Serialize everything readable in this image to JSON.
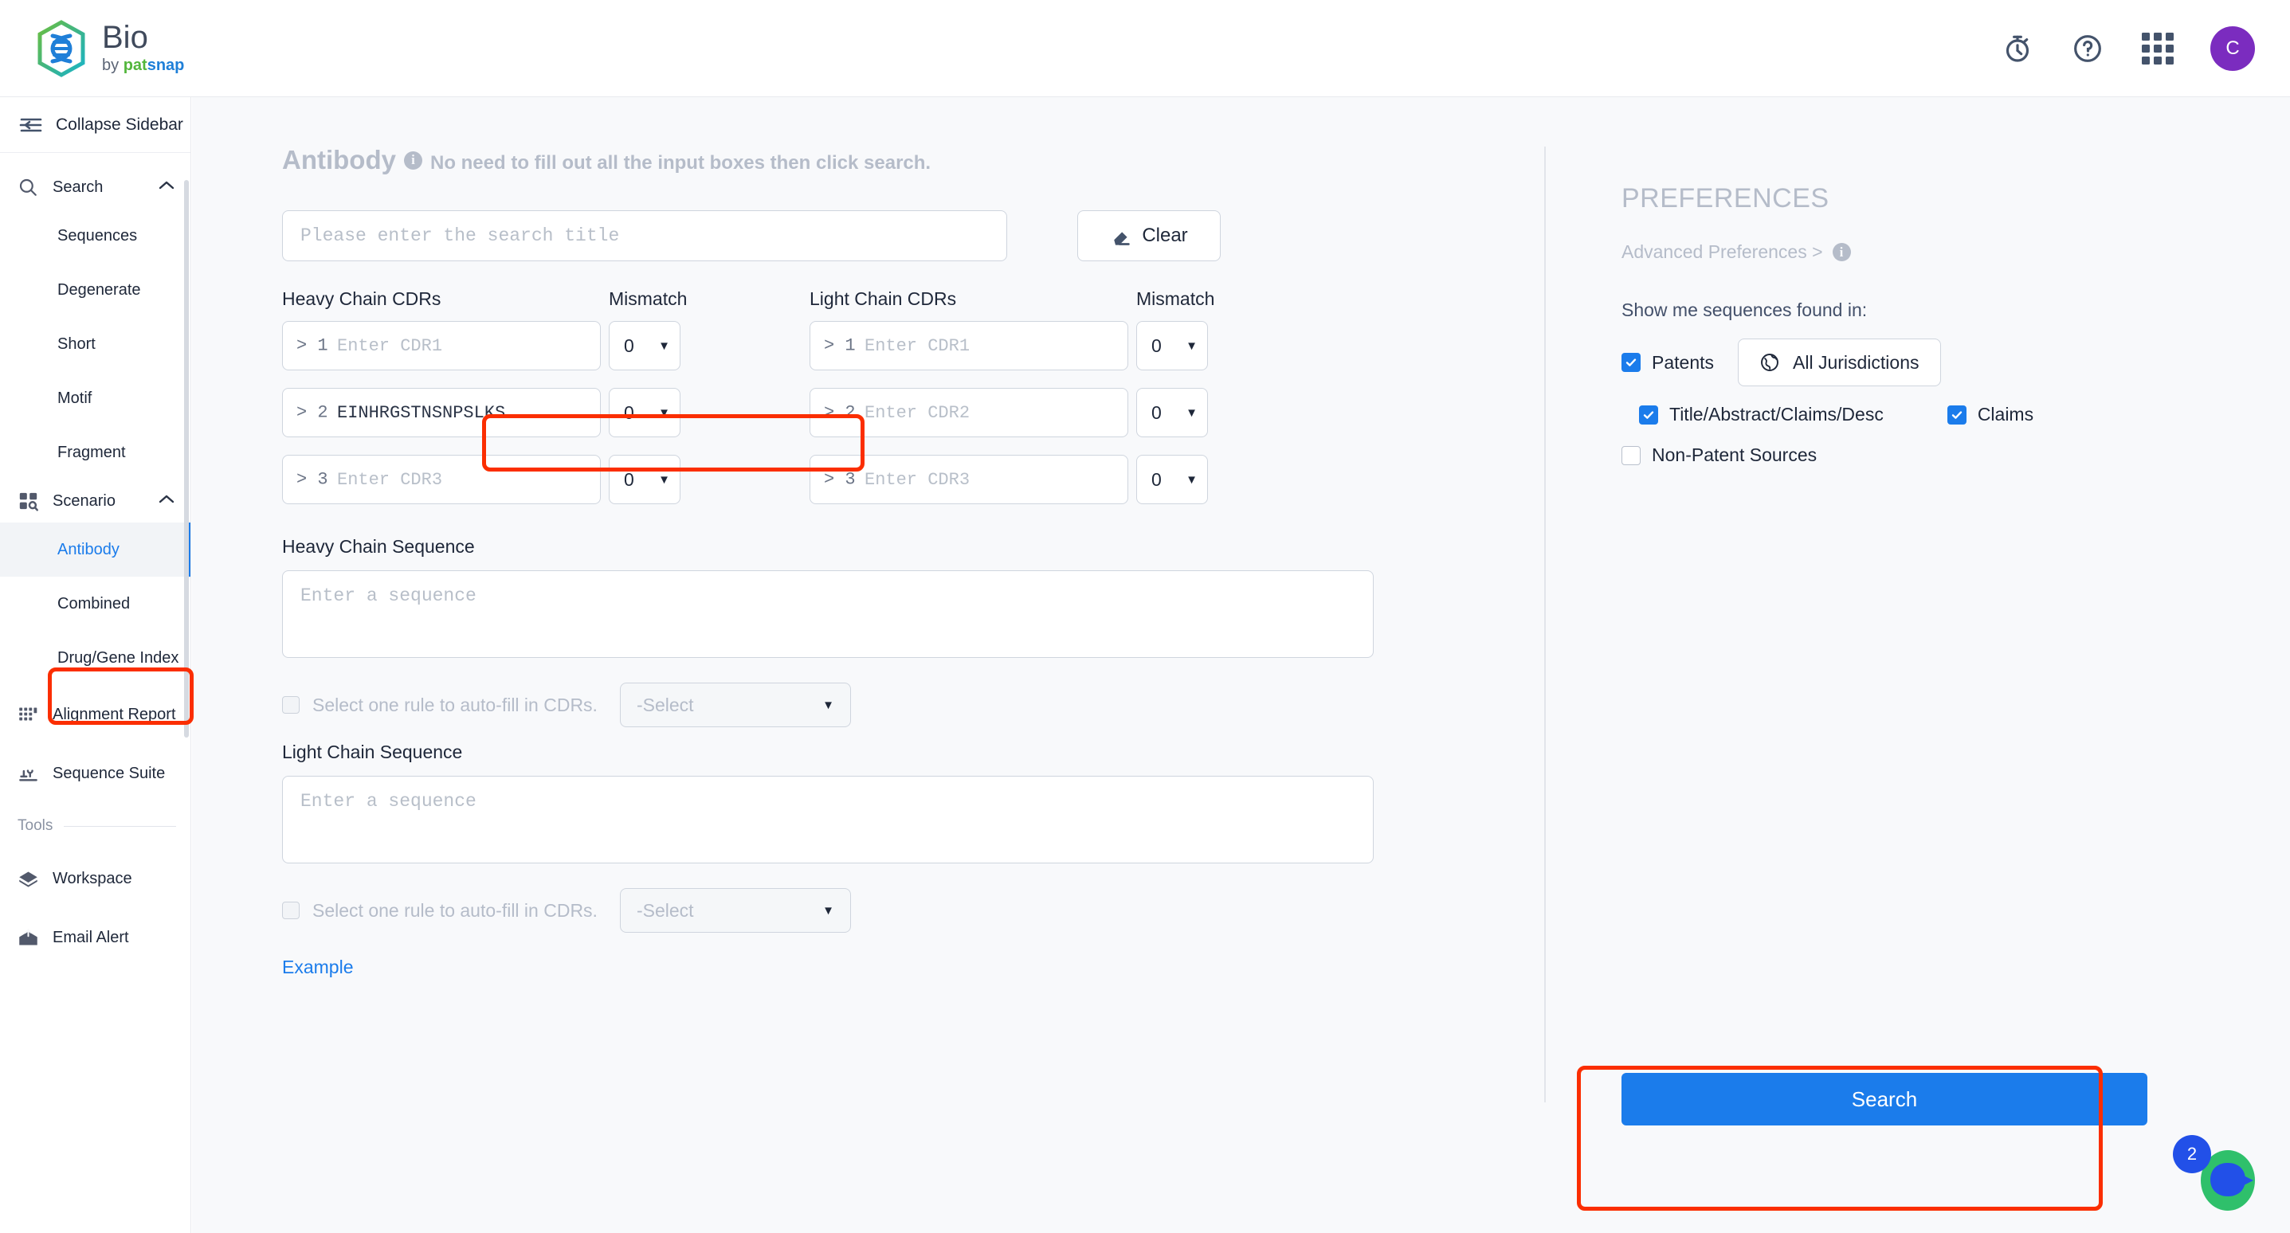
{
  "header": {
    "brand_name": "Bio",
    "brand_by": "by ",
    "brand_pat": "pat",
    "brand_s": "s",
    "brand_nap": "nap",
    "icons": {
      "timer": "timer-icon",
      "help": "help-icon",
      "apps": "apps-grid-icon"
    },
    "avatar_initial": "C"
  },
  "sidebar": {
    "collapse_label": "Collapse Sidebar",
    "search_group": {
      "label": "Search",
      "items": [
        {
          "label": "Sequences"
        },
        {
          "label": "Degenerate"
        },
        {
          "label": "Short"
        },
        {
          "label": "Motif"
        },
        {
          "label": "Fragment"
        }
      ]
    },
    "scenario_group": {
      "label": "Scenario",
      "items": [
        {
          "label": "Antibody",
          "active": true
        },
        {
          "label": "Combined",
          "active": false
        },
        {
          "label": "Drug/Gene Index",
          "active": false
        }
      ]
    },
    "links": [
      {
        "label": "Alignment Report"
      },
      {
        "label": "Sequence Suite"
      }
    ],
    "tools_label": "Tools",
    "tools": [
      {
        "label": "Workspace"
      },
      {
        "label": "Email Alert"
      }
    ]
  },
  "main": {
    "page_title": "Antibody",
    "page_hint": "No need to fill out all the input boxes then click search.",
    "title_input": {
      "placeholder": "Please enter the search title",
      "value": ""
    },
    "clear_label": "Clear",
    "columns": {
      "heavy_label": "Heavy Chain CDRs",
      "mismatch_label": "Mismatch",
      "light_label": "Light Chain CDRs",
      "mismatch_label2": "Mismatch"
    },
    "heavy_cdrs": [
      {
        "prefix": "> 1",
        "placeholder": "Enter CDR1",
        "value": "",
        "mismatch": "0"
      },
      {
        "prefix": "> 2",
        "placeholder": "Enter CDR2",
        "value": "EINHRGSTNSNPSLKS",
        "mismatch": "0"
      },
      {
        "prefix": "> 3",
        "placeholder": "Enter CDR3",
        "value": "",
        "mismatch": "0"
      }
    ],
    "light_cdrs": [
      {
        "prefix": "> 1",
        "placeholder": "Enter CDR1",
        "value": "",
        "mismatch": "0"
      },
      {
        "prefix": "> 2",
        "placeholder": "Enter CDR2",
        "value": "",
        "mismatch": "0"
      },
      {
        "prefix": "> 3",
        "placeholder": "Enter CDR3",
        "value": "",
        "mismatch": "0"
      }
    ],
    "heavy_sequence": {
      "label": "Heavy Chain Sequence",
      "placeholder": "Enter a sequence",
      "value": "",
      "rule_text": "Select one rule to auto-fill in CDRs.",
      "rule_select": "-Select"
    },
    "light_sequence": {
      "label": "Light Chain Sequence",
      "placeholder": "Enter a sequence",
      "value": "",
      "rule_text": "Select one rule to auto-fill in CDRs.",
      "rule_select": "-Select"
    },
    "example_label": "Example"
  },
  "preferences": {
    "title": "PREFERENCES",
    "advanced_label": "Advanced Preferences >",
    "show_label": "Show me sequences found in:",
    "patents_label": "Patents",
    "jurisdictions_label": "All Jurisdictions",
    "title_abstract_label": "Title/Abstract/Claims/Desc",
    "claims_label": "Claims",
    "non_patent_label": "Non-Patent Sources"
  },
  "search_button_label": "Search",
  "chat": {
    "badge_count": "2"
  },
  "colors": {
    "accent_blue": "#1b7ceb",
    "annotation_red": "#fb2e01",
    "avatar_purple": "#7b2cbf",
    "muted_gray": "#b5bcc9"
  }
}
